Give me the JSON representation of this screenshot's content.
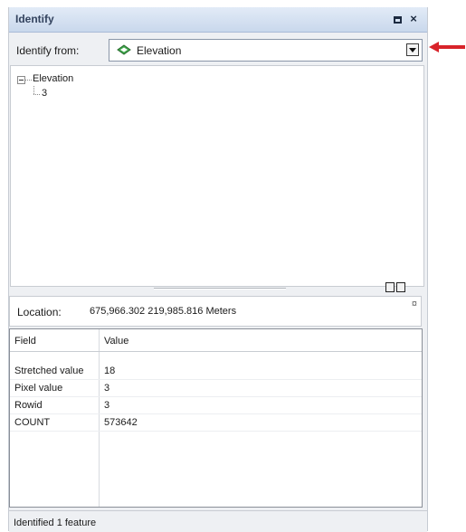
{
  "window": {
    "title": "Identify",
    "restore_icon": "restore-window-icon",
    "close_label": "×"
  },
  "identify_from": {
    "label": "Identify from:",
    "selected": "Elevation",
    "icon": "raster-layer-icon"
  },
  "tree": {
    "root_label": "Elevation",
    "children": [
      "3"
    ]
  },
  "location": {
    "label": "Location:",
    "value": "675,966.302  219,985.816 Meters",
    "menu_glyph": "¤"
  },
  "attributes": {
    "columns": [
      "Field",
      "Value"
    ],
    "rows": [
      {
        "field": "Stretched value",
        "value": "18"
      },
      {
        "field": "Pixel value",
        "value": "3"
      },
      {
        "field": "Rowid",
        "value": "3"
      },
      {
        "field": "COUNT",
        "value": "573642"
      }
    ]
  },
  "status": {
    "text": "Identified 1 feature"
  },
  "colors": {
    "annotation_arrow": "#d8232a",
    "titlebar": "#c9d8ec",
    "layer_icon_fill": "#3ea84a"
  }
}
